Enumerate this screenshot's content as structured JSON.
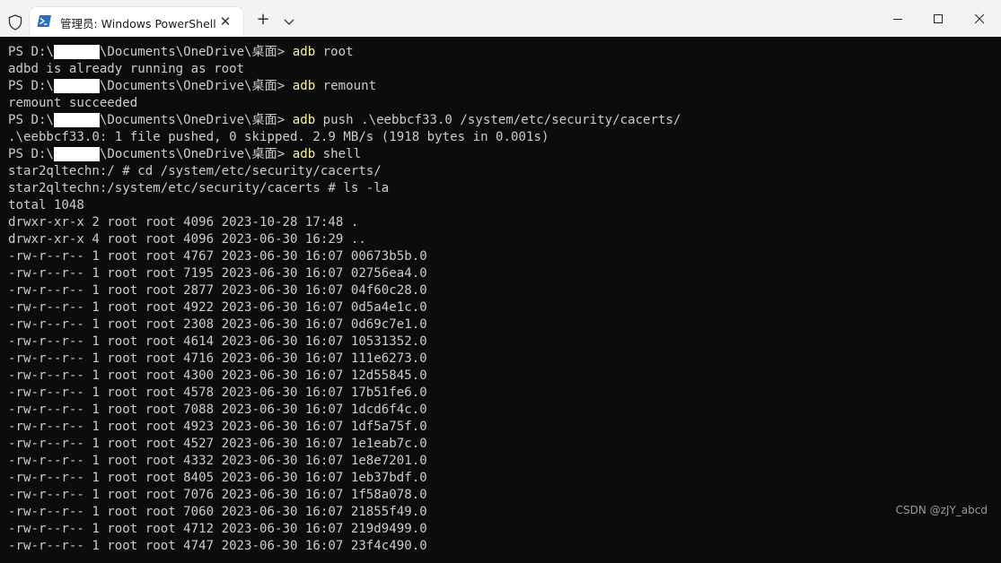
{
  "window": {
    "tab_title": "管理员: Windows PowerShell",
    "tab_close_label": "✕",
    "new_tab_label": "+",
    "icons": {
      "shield": "shield-icon",
      "powershell": "powershell-icon",
      "dropdown": "chevron-down-icon",
      "minimize": "minimize-icon",
      "maximize": "maximize-icon",
      "close": "close-icon"
    }
  },
  "terminal": {
    "colors": {
      "background": "#0c0c0c",
      "text": "#cccccc",
      "command": "#f9f1a5"
    },
    "lines": [
      {
        "parts": [
          {
            "t": "PS D:\\",
            "c": "txt"
          },
          {
            "t": "      ",
            "c": "redact"
          },
          {
            "t": "\\Documents\\OneDrive\\桌面> ",
            "c": "txt"
          },
          {
            "t": "adb",
            "c": "cmd"
          },
          {
            "t": " root",
            "c": "txt"
          }
        ]
      },
      {
        "parts": [
          {
            "t": "adbd is already running as root",
            "c": "txt"
          }
        ]
      },
      {
        "parts": [
          {
            "t": "PS D:\\",
            "c": "txt"
          },
          {
            "t": "      ",
            "c": "redact"
          },
          {
            "t": "\\Documents\\OneDrive\\桌面> ",
            "c": "txt"
          },
          {
            "t": "adb",
            "c": "cmd"
          },
          {
            "t": " remount",
            "c": "txt"
          }
        ]
      },
      {
        "parts": [
          {
            "t": "remount succeeded",
            "c": "txt"
          }
        ]
      },
      {
        "parts": [
          {
            "t": "PS D:\\",
            "c": "txt"
          },
          {
            "t": "      ",
            "c": "redact"
          },
          {
            "t": "\\Documents\\OneDrive\\桌面> ",
            "c": "txt"
          },
          {
            "t": "adb",
            "c": "cmd"
          },
          {
            "t": " push .\\eebbcf33.0 /system/etc/security/cacerts/",
            "c": "txt"
          }
        ]
      },
      {
        "parts": [
          {
            "t": ".\\eebbcf33.0: 1 file pushed, 0 skipped. 2.9 MB/s (1918 bytes in 0.001s)",
            "c": "txt"
          }
        ]
      },
      {
        "parts": [
          {
            "t": "PS D:\\",
            "c": "txt"
          },
          {
            "t": "      ",
            "c": "redact"
          },
          {
            "t": "\\Documents\\OneDrive\\桌面> ",
            "c": "txt"
          },
          {
            "t": "adb",
            "c": "cmd"
          },
          {
            "t": " shell",
            "c": "txt"
          }
        ]
      },
      {
        "parts": [
          {
            "t": "star2qltechn:/ # cd /system/etc/security/cacerts/",
            "c": "txt"
          }
        ]
      },
      {
        "parts": [
          {
            "t": "star2qltechn:/system/etc/security/cacerts # ls -la",
            "c": "txt"
          }
        ]
      },
      {
        "parts": [
          {
            "t": "total 1048",
            "c": "txt"
          }
        ]
      },
      {
        "parts": [
          {
            "t": "drwxr-xr-x 2 root root 4096 2023-10-28 17:48 .",
            "c": "txt"
          }
        ]
      },
      {
        "parts": [
          {
            "t": "drwxr-xr-x 4 root root 4096 2023-06-30 16:29 ..",
            "c": "txt"
          }
        ]
      },
      {
        "parts": [
          {
            "t": "-rw-r--r-- 1 root root 4767 2023-06-30 16:07 00673b5b.0",
            "c": "txt"
          }
        ]
      },
      {
        "parts": [
          {
            "t": "-rw-r--r-- 1 root root 7195 2023-06-30 16:07 02756ea4.0",
            "c": "txt"
          }
        ]
      },
      {
        "parts": [
          {
            "t": "-rw-r--r-- 1 root root 2877 2023-06-30 16:07 04f60c28.0",
            "c": "txt"
          }
        ]
      },
      {
        "parts": [
          {
            "t": "-rw-r--r-- 1 root root 4922 2023-06-30 16:07 0d5a4e1c.0",
            "c": "txt"
          }
        ]
      },
      {
        "parts": [
          {
            "t": "-rw-r--r-- 1 root root 2308 2023-06-30 16:07 0d69c7e1.0",
            "c": "txt"
          }
        ]
      },
      {
        "parts": [
          {
            "t": "-rw-r--r-- 1 root root 4614 2023-06-30 16:07 10531352.0",
            "c": "txt"
          }
        ]
      },
      {
        "parts": [
          {
            "t": "-rw-r--r-- 1 root root 4716 2023-06-30 16:07 111e6273.0",
            "c": "txt"
          }
        ]
      },
      {
        "parts": [
          {
            "t": "-rw-r--r-- 1 root root 4300 2023-06-30 16:07 12d55845.0",
            "c": "txt"
          }
        ]
      },
      {
        "parts": [
          {
            "t": "-rw-r--r-- 1 root root 4578 2023-06-30 16:07 17b51fe6.0",
            "c": "txt"
          }
        ]
      },
      {
        "parts": [
          {
            "t": "-rw-r--r-- 1 root root 7088 2023-06-30 16:07 1dcd6f4c.0",
            "c": "txt"
          }
        ]
      },
      {
        "parts": [
          {
            "t": "-rw-r--r-- 1 root root 4923 2023-06-30 16:07 1df5a75f.0",
            "c": "txt"
          }
        ]
      },
      {
        "parts": [
          {
            "t": "-rw-r--r-- 1 root root 4527 2023-06-30 16:07 1e1eab7c.0",
            "c": "txt"
          }
        ]
      },
      {
        "parts": [
          {
            "t": "-rw-r--r-- 1 root root 4332 2023-06-30 16:07 1e8e7201.0",
            "c": "txt"
          }
        ]
      },
      {
        "parts": [
          {
            "t": "-rw-r--r-- 1 root root 8405 2023-06-30 16:07 1eb37bdf.0",
            "c": "txt"
          }
        ]
      },
      {
        "parts": [
          {
            "t": "-rw-r--r-- 1 root root 7076 2023-06-30 16:07 1f58a078.0",
            "c": "txt"
          }
        ]
      },
      {
        "parts": [
          {
            "t": "-rw-r--r-- 1 root root 7060 2023-06-30 16:07 21855f49.0",
            "c": "txt"
          }
        ]
      },
      {
        "parts": [
          {
            "t": "-rw-r--r-- 1 root root 4712 2023-06-30 16:07 219d9499.0",
            "c": "txt"
          }
        ]
      },
      {
        "parts": [
          {
            "t": "-rw-r--r-- 1 root root 4747 2023-06-30 16:07 23f4c490.0",
            "c": "txt"
          }
        ]
      }
    ]
  },
  "watermark": "CSDN @zJY_abcd"
}
